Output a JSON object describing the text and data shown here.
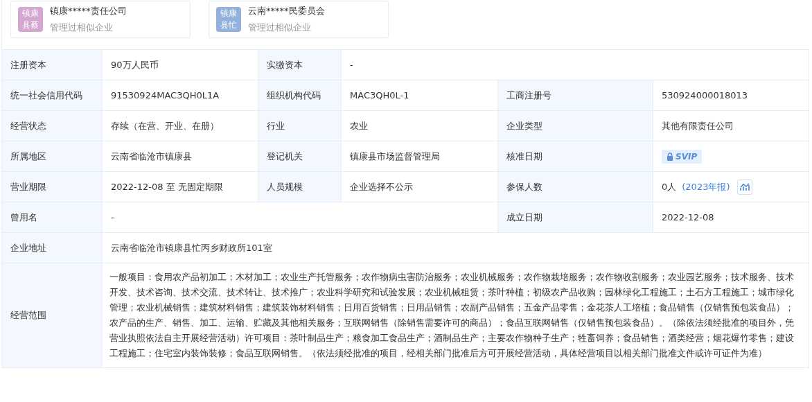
{
  "cards": [
    {
      "avatar": "镇康县蔡",
      "color": "#d3a7d1",
      "name": "镇康*****责任公司",
      "note": "管理过相似企业"
    },
    {
      "avatar": "镇康县忙",
      "color": "#94b0dc",
      "name": "云南*****民委员会",
      "note": "管理过相似企业"
    }
  ],
  "rows": [
    {
      "cells": [
        {
          "kind": "label",
          "text": "注册资本"
        },
        {
          "kind": "value",
          "text": "90万人民币"
        },
        {
          "kind": "label",
          "text": "实缴资本"
        },
        {
          "kind": "wide",
          "text": "-"
        }
      ]
    },
    {
      "cells": [
        {
          "kind": "label",
          "text": "统一社会信用代码"
        },
        {
          "kind": "value",
          "text": "91530924MAC3QH0L1A"
        },
        {
          "kind": "label",
          "text": "组织机构代码"
        },
        {
          "kind": "value",
          "text": "MAC3QH0L-1"
        },
        {
          "kind": "label",
          "text": "工商注册号"
        },
        {
          "kind": "value",
          "text": "530924000018013"
        }
      ]
    },
    {
      "cells": [
        {
          "kind": "label",
          "text": "经营状态"
        },
        {
          "kind": "value",
          "text": "存续（在营、开业、在册）"
        },
        {
          "kind": "label",
          "text": "行业"
        },
        {
          "kind": "value",
          "text": "农业"
        },
        {
          "kind": "label",
          "text": "企业类型"
        },
        {
          "kind": "value",
          "text": "其他有限责任公司"
        }
      ]
    },
    {
      "cells": [
        {
          "kind": "label",
          "text": "所属地区"
        },
        {
          "kind": "value",
          "text": "云南省临沧市镇康县"
        },
        {
          "kind": "label",
          "text": "登记机关"
        },
        {
          "kind": "value",
          "text": "镇康县市场监督管理局"
        },
        {
          "kind": "label",
          "text": "核准日期"
        },
        {
          "kind": "vip",
          "text": "SVIP"
        }
      ]
    },
    {
      "cells": [
        {
          "kind": "label",
          "text": "营业期限"
        },
        {
          "kind": "value",
          "text": "2022-12-08 至 无固定期限"
        },
        {
          "kind": "label",
          "text": "人员规模"
        },
        {
          "kind": "value",
          "text": "企业选择不公示"
        },
        {
          "kind": "label",
          "text": "参保人数"
        },
        {
          "kind": "insured",
          "text": "0人",
          "link": "(2023年报)"
        }
      ]
    },
    {
      "cells": [
        {
          "kind": "label",
          "text": "曾用名"
        },
        {
          "kind": "wide",
          "text": "-"
        },
        {
          "kind": "label",
          "text": "成立日期"
        },
        {
          "kind": "value",
          "text": "2022-12-08"
        }
      ]
    },
    {
      "cells": [
        {
          "kind": "label",
          "text": "企业地址"
        },
        {
          "kind": "wide",
          "text": "云南省临沧市镇康县忙丙乡财政所101室"
        }
      ]
    },
    {
      "cells": [
        {
          "kind": "label",
          "text": "经营范围"
        },
        {
          "kind": "wide",
          "text": "一般项目：食用农产品初加工；木材加工；农业生产托管服务；农作物病虫害防治服务；农业机械服务；农作物栽培服务；农作物收割服务；农业园艺服务；技术服务、技术开发、技术咨询、技术交流、技术转让、技术推广；农业科学研究和试验发展；农业机械租赁；茶叶种植；初级农产品收购；园林绿化工程施工；土石方工程施工；城市绿化管理；农业机械销售；建筑材料销售；建筑装饰材料销售；日用百货销售；日用品销售；农副产品销售；五金产品零售；金花茶人工培植；食品销售（仅销售预包装食品）；农产品的生产、销售、加工、运输、贮藏及其他相关服务；互联网销售（除销售需要许可的商品）；食品互联网销售（仅销售预包装食品）。（除依法须经批准的项目外，凭营业执照依法自主开展经营活动）许可项目：茶叶制品生产；粮食加工食品生产；酒制品生产；主要农作物种子生产；牲畜饲养；食品销售；酒类经营；烟花爆竹零售；建设工程施工；住宅室内装饰装修；食品互联网销售。（依法须经批准的项目，经相关部门批准后方可开展经营活动，具体经营项目以相关部门批准文件或许可证件为准）"
        }
      ]
    }
  ]
}
